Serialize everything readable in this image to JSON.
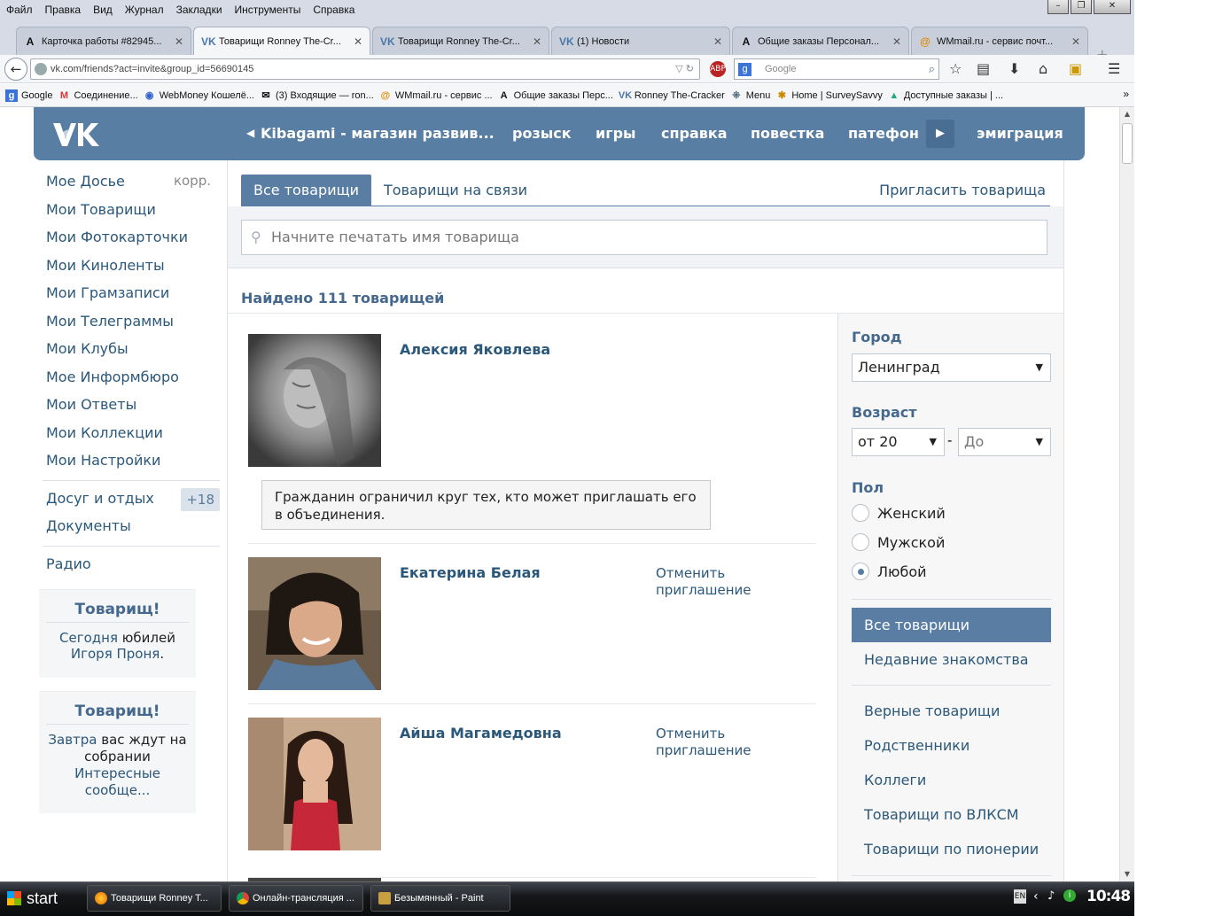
{
  "menubar": {
    "items": [
      "Файл",
      "Правка",
      "Вид",
      "Журнал",
      "Закладки",
      "Инструменты",
      "Справка"
    ]
  },
  "tabs": [
    {
      "label": "Карточка работы #82945...",
      "icon": "A"
    },
    {
      "label": "Товарищи Ronney The-Cr...",
      "icon": "vk"
    },
    {
      "label": "Товарищи Ronney The-Cr...",
      "icon": "vk"
    },
    {
      "label": "(1) Новости",
      "icon": "vk"
    },
    {
      "label": "Общие заказы Персонал...",
      "icon": "A"
    },
    {
      "label": "WMmail.ru - сервис почт...",
      "icon": "@"
    }
  ],
  "url": "vk.com/friends?act=invite&group_id=56690145",
  "search": {
    "placeholder": "Google"
  },
  "bookmarks": [
    "Google",
    "Соединение...",
    "WebMoney Кошелё...",
    "(3) Входящие — ron...",
    "WMmail.ru - сервис ...",
    "Общие заказы Перс...",
    "Ronney The-Cracker",
    "Menu",
    "Home | SurveySavvy",
    "Доступные заказы | ..."
  ],
  "vk": {
    "logo": "VK",
    "topnav": [
      "Kibagami - магазин развив...",
      "розыск",
      "игры",
      "справка",
      "повестка",
      "патефон",
      "эмиграция"
    ],
    "leftnav": [
      {
        "label": "Мое Досье",
        "right": "корр."
      },
      {
        "label": "Мои Товарищи"
      },
      {
        "label": "Мои Фотокарточки"
      },
      {
        "label": "Мои Киноленты"
      },
      {
        "label": "Мои Грамзаписи"
      },
      {
        "label": "Мои Телеграммы"
      },
      {
        "label": "Мои Клубы"
      },
      {
        "label": "Мое Информбюро"
      },
      {
        "label": "Мои Ответы"
      },
      {
        "label": "Мои Коллекции"
      },
      {
        "label": "Мои Настройки"
      }
    ],
    "leftnav2": [
      {
        "label": "Досуг и отдых",
        "count": "+18"
      },
      {
        "label": "Документы"
      }
    ],
    "leftnav3": [
      {
        "label": "Радио"
      }
    ],
    "promo1": {
      "title": "Товарищ!",
      "l1a": "Сегодня",
      "l1b": " юбилей",
      "l2a": "Игоря Проня",
      "l2b": "."
    },
    "promo2": {
      "title": "Товарищ!",
      "l1a": "Завтра",
      "l1b": " вас ждут на собрании",
      "l2": "Интересные сообще..."
    },
    "main": {
      "tab_all": "Все товарищи",
      "tab_online": "Товарищи на связи",
      "invite": "Пригласить товарища",
      "search_placeholder": "Начните печатать имя товарища",
      "found": "Найдено 111 товарищей"
    },
    "friends": [
      {
        "name": "Алексия Яковлева",
        "note": "Гражданин ограничил круг тех, кто может приглашать его в объединения."
      },
      {
        "name": "Екатерина Белая",
        "action": "Отменить приглашение"
      },
      {
        "name": "Айша Магамедовна",
        "action": "Отменить приглашение"
      }
    ],
    "filters": {
      "city_label": "Город",
      "city_value": "Ленинград",
      "age_label": "Возраст",
      "age_from": "от 20",
      "age_dash": "-",
      "age_to": "До",
      "sex_label": "Пол",
      "sex_options": [
        "Женский",
        "Мужской",
        "Любой"
      ],
      "sex_selected": "Любой",
      "nav": [
        "Все товарищи",
        "Недавние знакомства",
        "Верные товарищи",
        "Родственники",
        "Коллеги",
        "Товарищи по ВЛКСМ",
        "Товарищи по пионерии"
      ]
    }
  },
  "taskbar": {
    "start": "start",
    "tasks": [
      "Товарищи Ronney T...",
      "Онлайн-трансляция ...",
      "Безымянный - Paint"
    ],
    "lang": "EN",
    "clock": "10:48"
  },
  "colors": {
    "vk_blue": "#587ea3",
    "link": "#2b587a",
    "heading": "#45688e"
  }
}
